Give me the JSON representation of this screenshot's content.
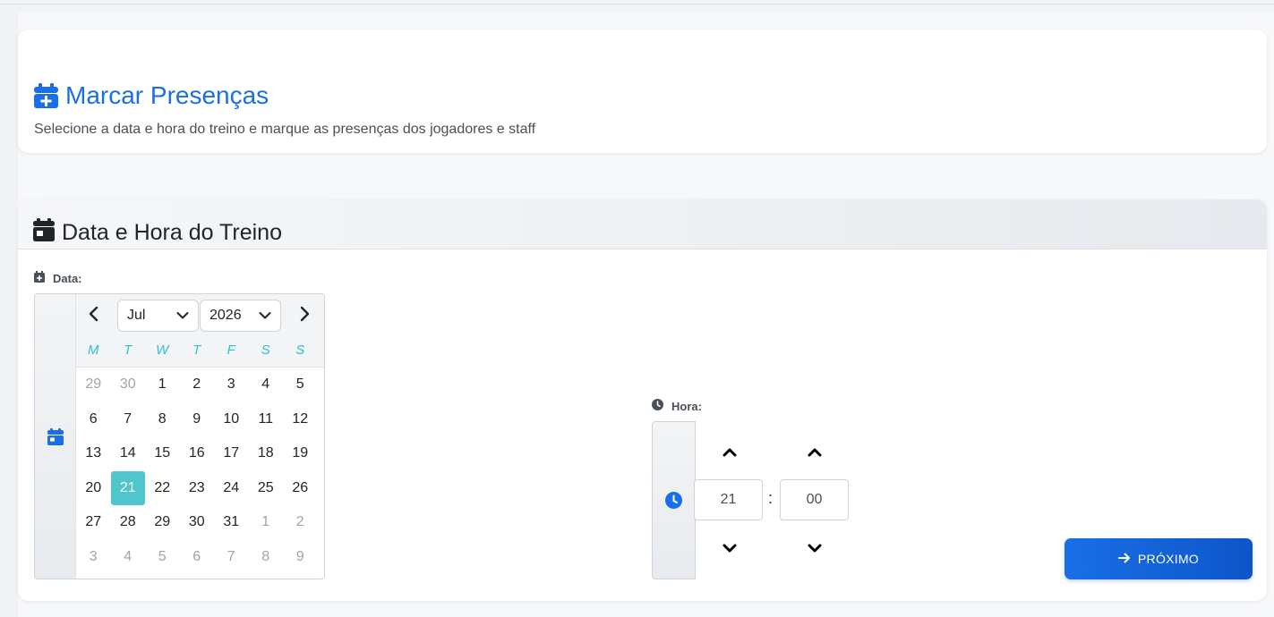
{
  "header": {
    "title": "Marcar Presenças",
    "subtitle": "Selecione a data e hora do treino e marque as presenças dos jogadores e staff",
    "icon": "calendar-plus-icon",
    "accent_color": "#1a6fe8"
  },
  "section": {
    "title": "Data e Hora do Treino",
    "icon": "calendar-icon"
  },
  "date_field": {
    "label": "Data:",
    "month": "Jul",
    "year": "2026",
    "weekdays": [
      "M",
      "T",
      "W",
      "T",
      "F",
      "S",
      "S"
    ],
    "weeks": [
      [
        {
          "d": "29",
          "m": true
        },
        {
          "d": "30",
          "m": true
        },
        {
          "d": "1"
        },
        {
          "d": "2"
        },
        {
          "d": "3"
        },
        {
          "d": "4"
        },
        {
          "d": "5"
        }
      ],
      [
        {
          "d": "6"
        },
        {
          "d": "7"
        },
        {
          "d": "8"
        },
        {
          "d": "9"
        },
        {
          "d": "10"
        },
        {
          "d": "11"
        },
        {
          "d": "12"
        }
      ],
      [
        {
          "d": "13"
        },
        {
          "d": "14"
        },
        {
          "d": "15"
        },
        {
          "d": "16"
        },
        {
          "d": "17"
        },
        {
          "d": "18"
        },
        {
          "d": "19"
        }
      ],
      [
        {
          "d": "20"
        },
        {
          "d": "21",
          "s": true
        },
        {
          "d": "22"
        },
        {
          "d": "23"
        },
        {
          "d": "24"
        },
        {
          "d": "25"
        },
        {
          "d": "26"
        }
      ],
      [
        {
          "d": "27"
        },
        {
          "d": "28"
        },
        {
          "d": "29"
        },
        {
          "d": "30"
        },
        {
          "d": "31"
        },
        {
          "d": "1",
          "m": true
        },
        {
          "d": "2",
          "m": true
        }
      ],
      [
        {
          "d": "3",
          "m": true
        },
        {
          "d": "4",
          "m": true
        },
        {
          "d": "5",
          "m": true
        },
        {
          "d": "6",
          "m": true
        },
        {
          "d": "7",
          "m": true
        },
        {
          "d": "8",
          "m": true
        },
        {
          "d": "9",
          "m": true
        }
      ]
    ],
    "selected_color": "#4fc6cc",
    "weekday_color": "#2ebfd6"
  },
  "time_field": {
    "label": "Hora:",
    "hour": "21",
    "minute": "00",
    "separator": ":"
  },
  "next_button": {
    "label": "PRÓXIMO",
    "icon": "arrow-right-icon"
  }
}
